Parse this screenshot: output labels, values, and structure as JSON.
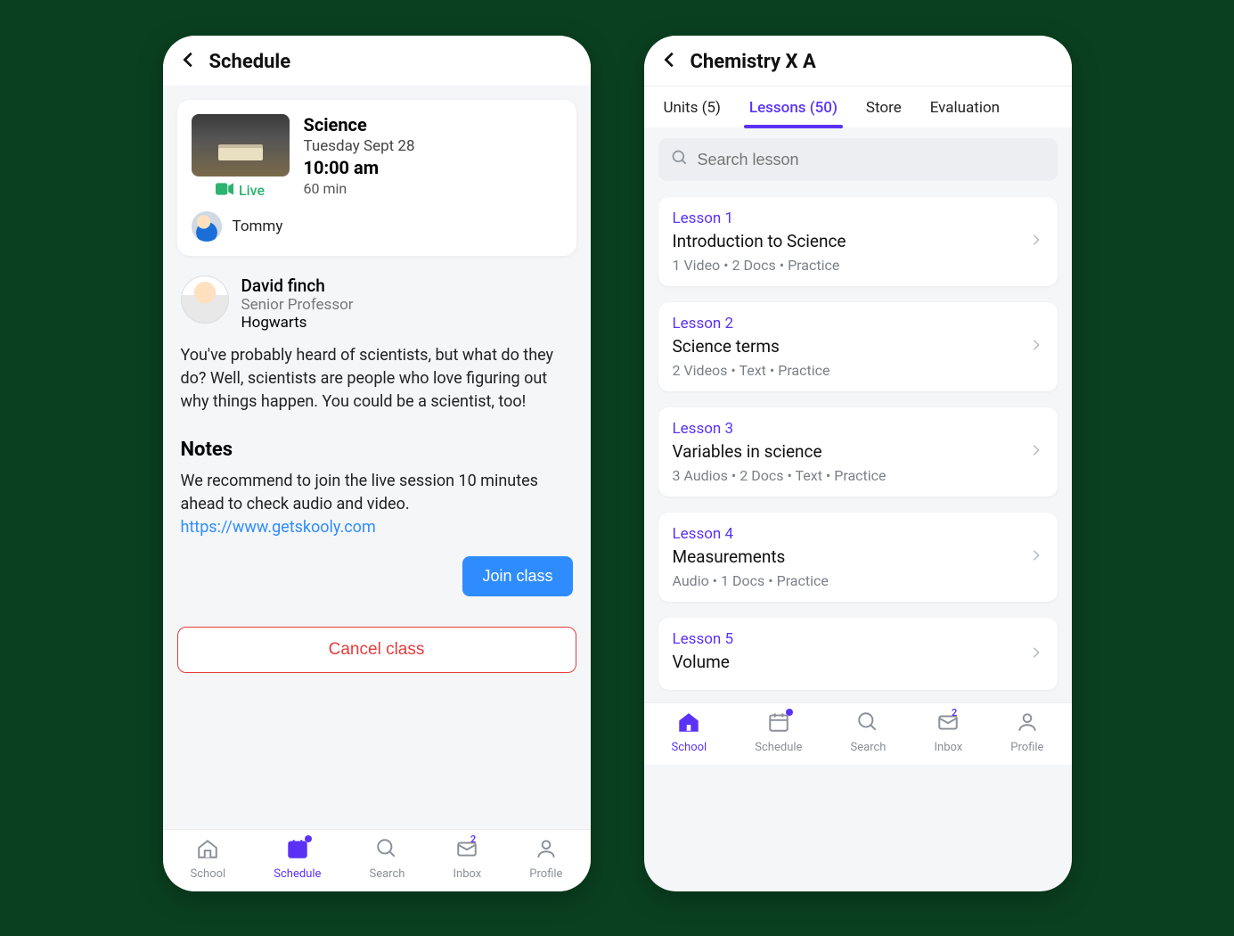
{
  "colors": {
    "accent": "#5b32f5",
    "primary_btn": "#2e8cff",
    "danger": "#e63b3b",
    "live": "#2db36f"
  },
  "nav": {
    "items": [
      "School",
      "Schedule",
      "Search",
      "Inbox",
      "Profile"
    ],
    "inbox_badge": "2"
  },
  "left": {
    "title": "Schedule",
    "nav_active_index": 1,
    "classCard": {
      "subject": "Science",
      "date": "Tuesday Sept 28",
      "time": "10:00 am",
      "duration": "60 min",
      "live_label": "Live",
      "student": "Tommy"
    },
    "instructor": {
      "name": "David finch",
      "role": "Senior Professor",
      "org": "Hogwarts"
    },
    "description": "You've probably heard of scientists, but what do they do? Well, scientists are people who love figuring out why things happen. You could be a scientist, too!",
    "notes_heading": "Notes",
    "notes_body": "We recommend to join the live session 10 minutes ahead to check audio and video.",
    "notes_link": "https://www.getskooly.com",
    "join_label": "Join class",
    "cancel_label": "Cancel class"
  },
  "right": {
    "title": "Chemistry X A",
    "nav_active_index": 0,
    "tabs": [
      "Units (5)",
      "Lessons (50)",
      "Store",
      "Evaluation"
    ],
    "active_tab_index": 1,
    "search_placeholder": "Search lesson",
    "lessons": [
      {
        "num": "Lesson 1",
        "title": "Introduction to Science",
        "meta": "1 Video  •  2 Docs  •  Practice"
      },
      {
        "num": "Lesson 2",
        "title": "Science terms",
        "meta": "2 Videos  •  Text  •  Practice"
      },
      {
        "num": "Lesson 3",
        "title": "Variables in science",
        "meta": "3 Audios  •  2 Docs  •  Text  •  Practice"
      },
      {
        "num": "Lesson 4",
        "title": "Measurements",
        "meta": "Audio  •  1 Docs  •  Practice"
      },
      {
        "num": "Lesson 5",
        "title": "Volume",
        "meta": ""
      }
    ]
  }
}
